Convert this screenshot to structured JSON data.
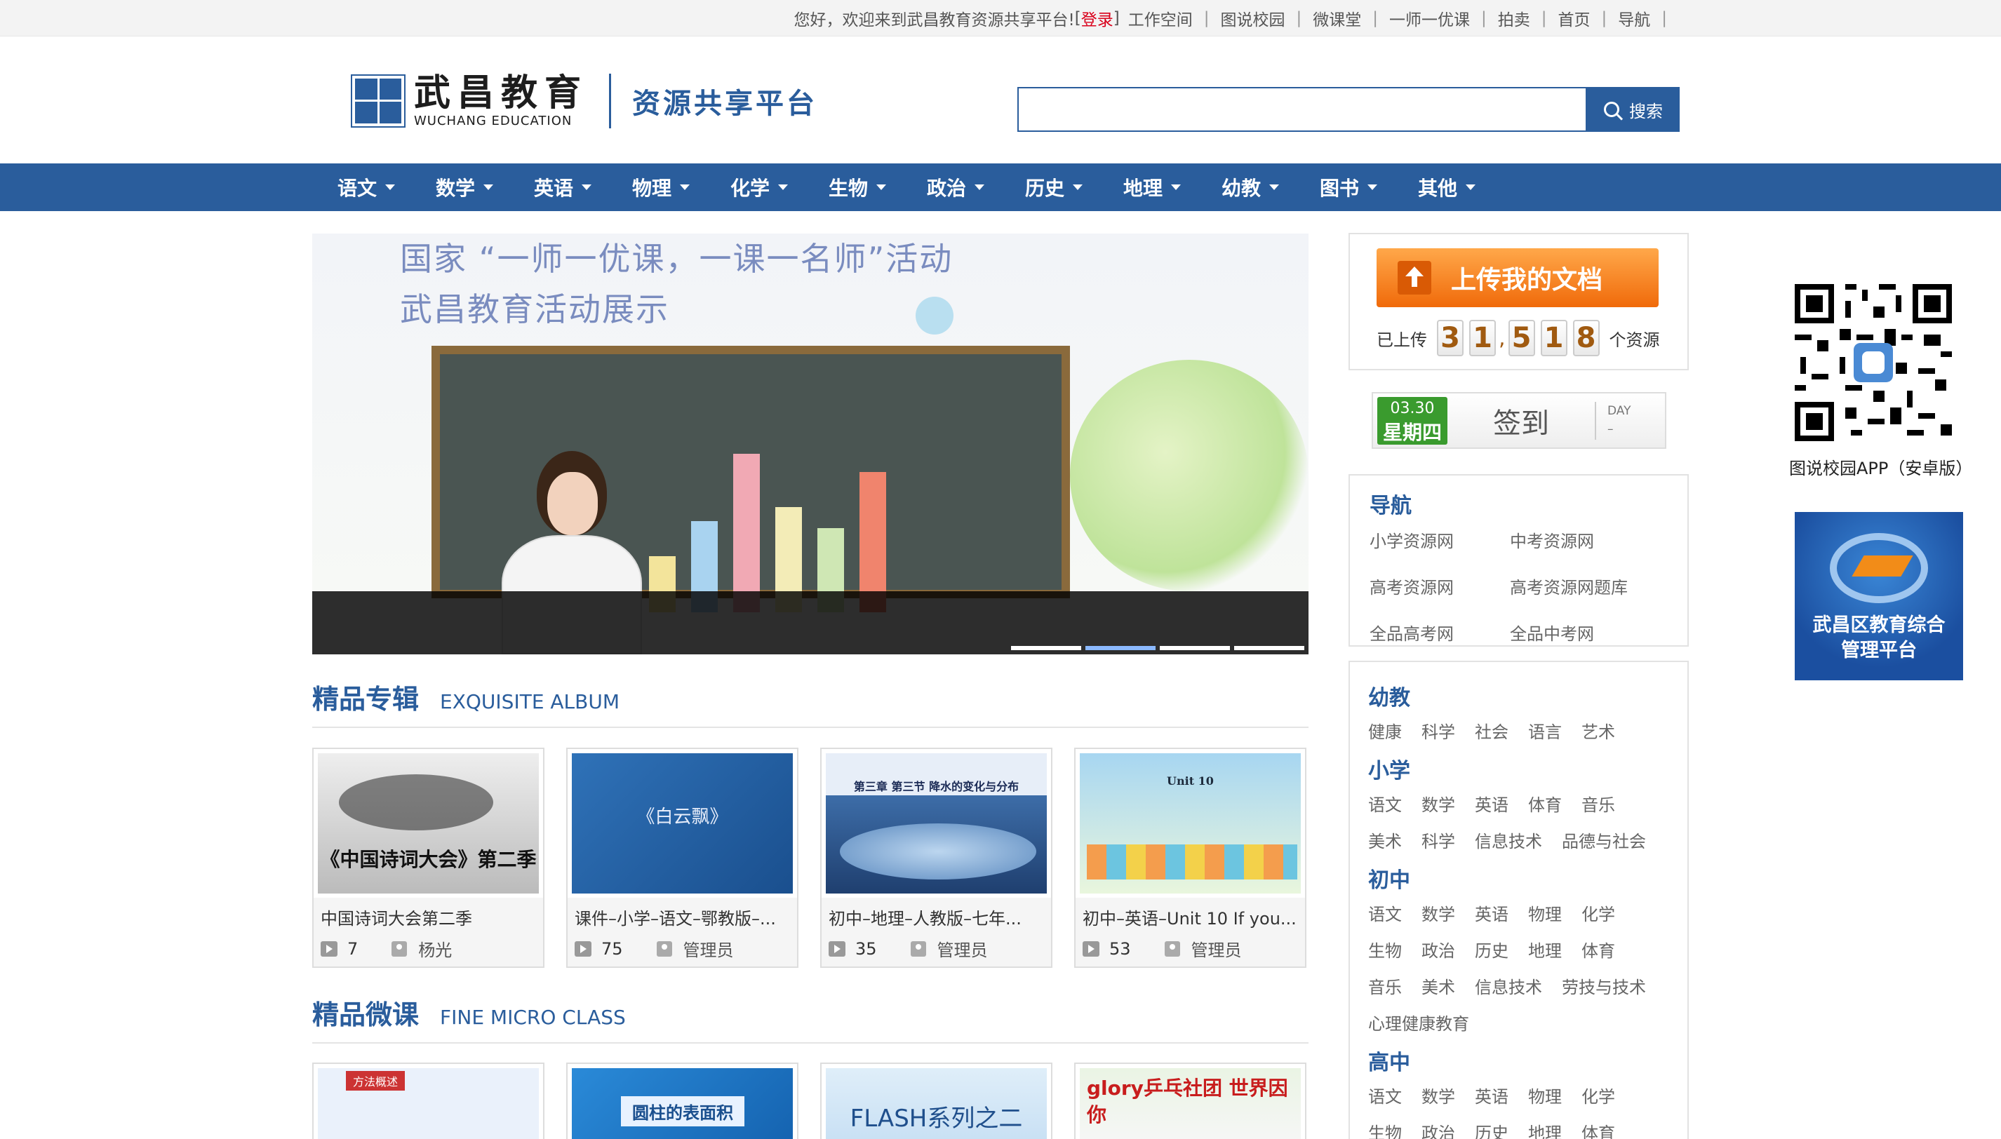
{
  "topbar": {
    "welcome": "您好，欢迎来到武昌教育资源共享平台!",
    "login_pre": "[",
    "login": "登录",
    "login_post": "]",
    "links": [
      "工作空间",
      "图说校园",
      "微课堂",
      "一师一优课",
      "拍卖",
      "首页",
      "导航"
    ]
  },
  "header": {
    "logo_cn": "武昌教育",
    "logo_en": "WUCHANG EDUCATION",
    "platform": "资源共享平台",
    "search_placeholder": "",
    "search_button": "搜索"
  },
  "nav": [
    "语文",
    "数学",
    "英语",
    "物理",
    "化学",
    "生物",
    "政治",
    "历史",
    "地理",
    "幼教",
    "图书",
    "其他"
  ],
  "banner": {
    "line1": "国家 “一师一优课，一课一名师”活动",
    "line2": "武昌教育活动展示",
    "slides": 4,
    "active_slide": 2
  },
  "album": {
    "title_cn": "精品专辑",
    "title_en": "EXQUISITE ALBUM",
    "items": [
      {
        "title": "中国诗词大会第二季",
        "count": "7",
        "user": "杨光"
      },
      {
        "title": "课件–小学–语文–鄂教版–...",
        "count": "75",
        "user": "管理员"
      },
      {
        "title": "初中–地理–人教版–七年...",
        "count": "35",
        "user": "管理员"
      },
      {
        "title": "初中–英语–Unit 10 If you...",
        "count": "53",
        "user": "管理员"
      }
    ],
    "thumb_text": [
      "《中国诗词大会》第二季",
      "《白云飘》",
      "第三章 第三节 降水的变化与分布",
      "Unit 10"
    ]
  },
  "micro": {
    "title_cn": "精品微课",
    "title_en": "FINE MICRO CLASS",
    "thumb_text": [
      "方法概述",
      "圆柱的表面积",
      "FLASH系列之二",
      "glory乒乓社团 世界因你"
    ]
  },
  "upload": {
    "button": "上传我的文档",
    "uploaded_label": "已上传",
    "digits": [
      "3",
      "1",
      "5",
      "1",
      "8"
    ],
    "comma": ",",
    "suffix": "个资源"
  },
  "signin": {
    "date": "03.30",
    "weekday": "星期四",
    "label": "签到",
    "day_label": "DAY",
    "day_value": "–"
  },
  "navbox": {
    "title": "导航",
    "links": [
      "小学资源网",
      "中考资源网",
      "高考资源网",
      "高考资源网题库",
      "全品高考网",
      "全品中考网"
    ]
  },
  "categories": [
    {
      "name": "幼教",
      "rows": [
        [
          "健康",
          "科学",
          "社会",
          "语言",
          "艺术"
        ]
      ]
    },
    {
      "name": "小学",
      "rows": [
        [
          "语文",
          "数学",
          "英语",
          "体育",
          "音乐"
        ],
        [
          "美术",
          "科学",
          "信息技术",
          "品德与社会"
        ]
      ]
    },
    {
      "name": "初中",
      "rows": [
        [
          "语文",
          "数学",
          "英语",
          "物理",
          "化学"
        ],
        [
          "生物",
          "政治",
          "历史",
          "地理",
          "体育"
        ],
        [
          "音乐",
          "美术",
          "信息技术",
          "劳技与技术"
        ],
        [
          "心理健康教育"
        ]
      ]
    },
    {
      "name": "高中",
      "rows": [
        [
          "语文",
          "数学",
          "英语",
          "物理",
          "化学"
        ],
        [
          "生物",
          "政治",
          "历史",
          "地理",
          "体育"
        ]
      ]
    }
  ],
  "side": {
    "qr_caption": "图说校园APP（安卓版）",
    "platform_text1": "武昌区教育综合",
    "platform_text2": "管理平台"
  },
  "colors": {
    "brand": "#2a5d9c",
    "accent": "#f06a0a",
    "login": "#d9001b"
  }
}
